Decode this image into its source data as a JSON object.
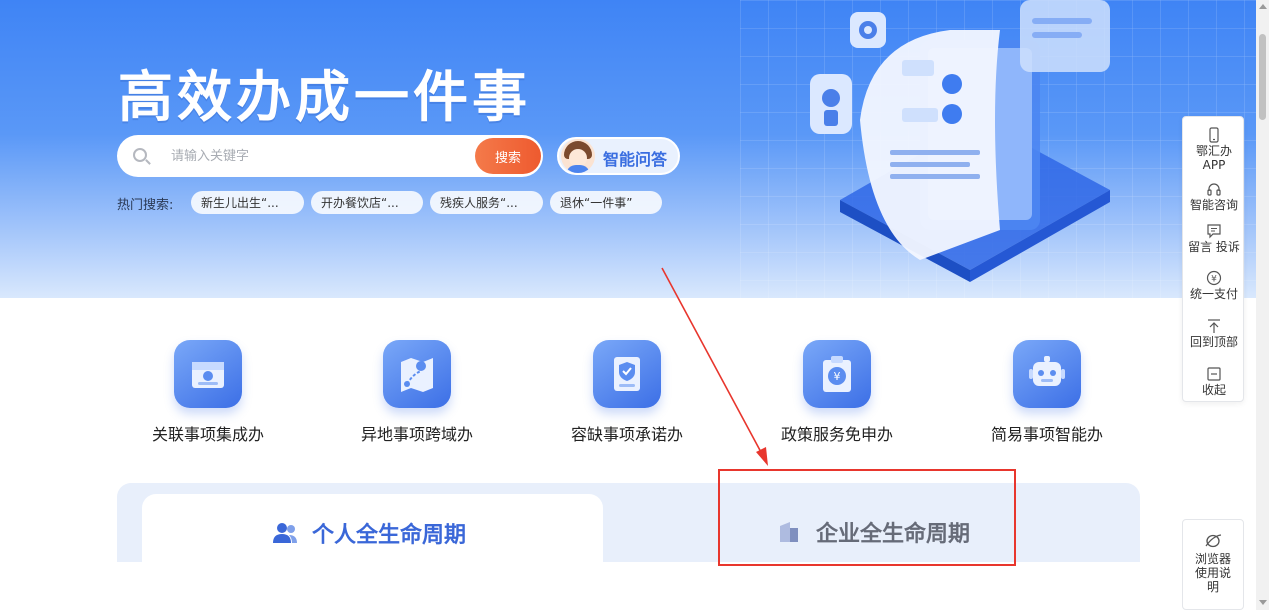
{
  "banner": {
    "title": "高效办成一件事",
    "search": {
      "placeholder": "请输入关键字",
      "button_label": "搜索"
    },
    "ai_button_label": "智能问答",
    "hot_search": {
      "label": "热门搜索:",
      "tags": [
        "新生儿出生“...",
        "开办餐饮店“...",
        "残疾人服务“...",
        "退休“一件事”"
      ]
    }
  },
  "services": [
    {
      "label": "关联事项集成办",
      "icon": "box-icon"
    },
    {
      "label": "异地事项跨域办",
      "icon": "map-route-icon"
    },
    {
      "label": "容缺事项承诺办",
      "icon": "document-shield-icon"
    },
    {
      "label": "政策服务免申办",
      "icon": "clipboard-yuan-icon"
    },
    {
      "label": "简易事项智能办",
      "icon": "robot-icon"
    }
  ],
  "lifecycle": {
    "tabs": [
      {
        "label": "个人全生命周期",
        "icon": "users-icon",
        "active": true
      },
      {
        "label": "企业全生命周期",
        "icon": "building-icon",
        "active": false
      }
    ]
  },
  "float_bar": {
    "items": [
      {
        "label": "鄂汇办APP",
        "icon": "phone-icon"
      },
      {
        "label": "智能咨询",
        "icon": "headset-icon"
      },
      {
        "label": "留言 投诉",
        "icon": "message-icon"
      },
      {
        "label": "统一支付",
        "icon": "yuan-icon"
      },
      {
        "label": "回到顶部",
        "icon": "arrow-top-icon"
      },
      {
        "label": "收起",
        "icon": "collapse-icon"
      }
    ]
  },
  "browser_help": {
    "label": "浏览器使用说明",
    "icon": "browser-icon"
  },
  "colors": {
    "banner_blue": "#3f84f5",
    "search_button": "#ee5a2f",
    "active_tab_text": "#3a67d8",
    "annotation_red": "#e8362d"
  }
}
